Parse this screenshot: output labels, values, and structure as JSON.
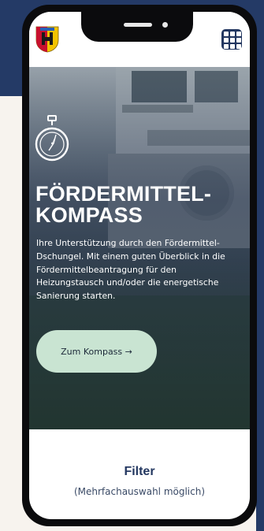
{
  "header": {
    "logo_icon": "city-crest-icon",
    "menu_icon": "grid-menu-icon"
  },
  "hero": {
    "icon": "compass-icon",
    "title_line1": "FÖRDERMITTEL-",
    "title_line2": "KOMPASS",
    "lead": "Ihre Unterstützung durch den Fördermittel-Dschungel. Mit einem guten Überblick in die Fördermittelbeantragung für den Heizungstausch und/oder die energetische Sanierung starten.",
    "cta_label": "Zum Kompass →"
  },
  "filter": {
    "title": "Filter",
    "hint": "(Mehrfachauswahl möglich)"
  },
  "colors": {
    "navy": "#243a66",
    "cream": "#f7f3ee",
    "cta_green": "#c9e4d2",
    "crest_red": "#c8102e",
    "crest_yellow": "#f2c300"
  }
}
